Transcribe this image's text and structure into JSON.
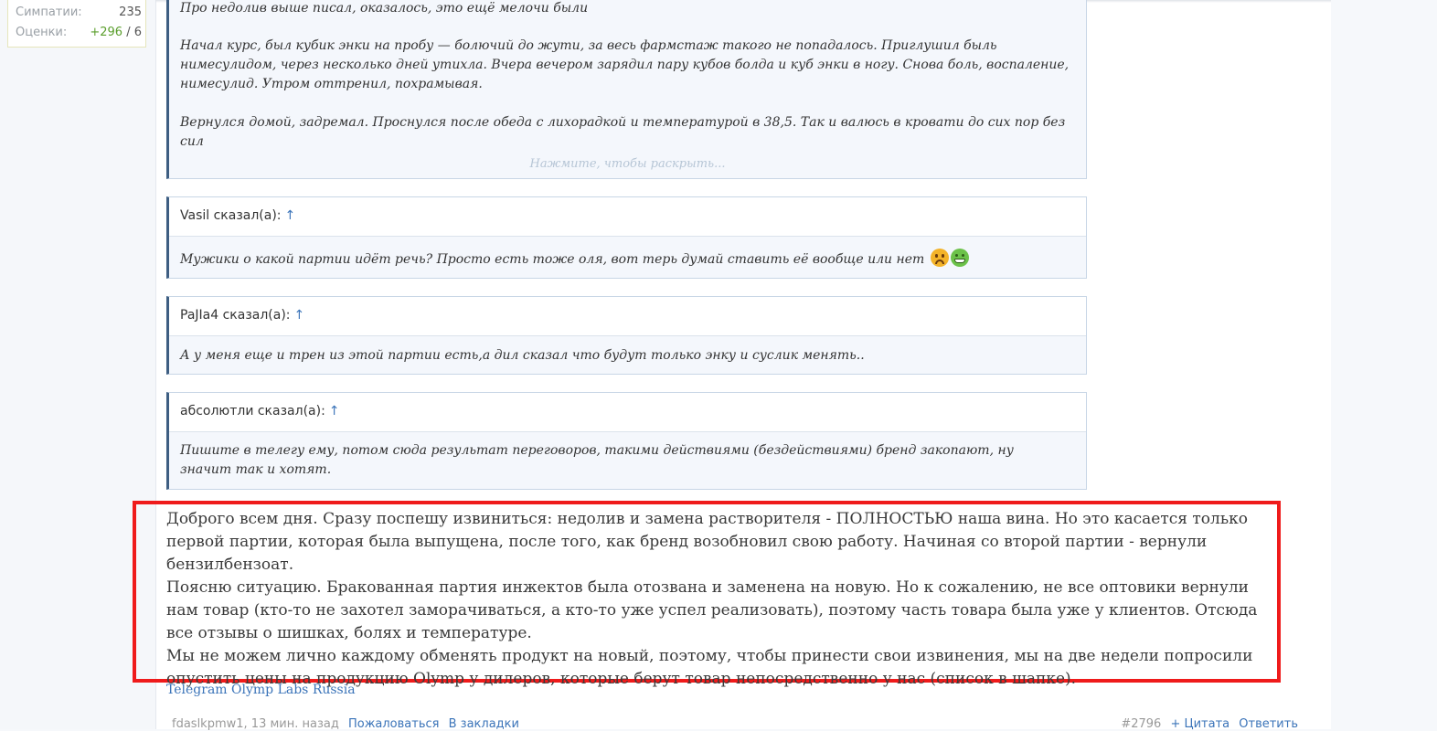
{
  "user_stats": {
    "likes_label": "Симпатии:",
    "likes_value": "235",
    "ratings_label": "Оценки:",
    "ratings_positive": "+296",
    "ratings_rest": " / 6"
  },
  "quotes": [
    {
      "paragraphs": [
        "Про недолив выше писал, оказалось, это ещё мелочи были",
        "Начал курс, был кубик энки на пробу — болючий до жути, за весь фармстаж такого не попадалось. Приглушил быль нимесулидом, через несколько дней утихла. Вчера вечером зарядил пару кубов болда и куб энки в ногу. Снова боль, воспаление, нимесулид. Утром оттренил, похрамывая.",
        "Вернулся домой, задремал. Проснулся после обеда с лихорадкой и температурой в 38,5. Так и валюсь в кровати до сих пор без сил"
      ],
      "expand_label": "Нажмите, чтобы раскрыть..."
    },
    {
      "author": "Vasil сказал(а):",
      "arrow": "↑",
      "text": "Мужики о какой партии идёт речь? Просто есть тоже оля, вот терь думай ставить её вообще или нет"
    },
    {
      "author": "PaJIa4 сказал(а):",
      "arrow": "↑",
      "text": "А у меня еще и трен из этой партии есть,а дил сказал что будут только энку и суслик менять.."
    },
    {
      "author": "абсолютли сказал(а):",
      "arrow": "↑",
      "text": "Пишите в телегу ему, потом сюда результат переговоров, такими действиями (бездействиями) бренд закопают, ну значит так и хотят."
    }
  ],
  "reply": {
    "paragraph1": "Доброго всем дня. Сразу поспешу извиниться: недолив и замена растворителя - ПОЛНОСТЬЮ наша вина. Но это касается только первой партии, которая была выпущена, после того, как бренд возобновил свою работу. Начиная со второй партии - вернули бензилбензоат.",
    "paragraph2": "Поясню ситуацию. Бракованная партия инжектов была отозвана и заменена на новую. Но к сожалению, не все оптовики вернули нам товар (кто-то не захотел заморачиваться, а кто-то уже успел реализовать), поэтому часть товара была уже у клиентов. Отсюда все отзывы о шишках, болях и температуре.",
    "paragraph3": "Мы не можем лично каждому обменять продукт на новый, поэтому, чтобы принести свои извинения, мы на две недели попросили опустить цены на продукцию Olymp у дилеров, которые берут товар непосредственно у нас (список в шапке)."
  },
  "signature_link": "Telegram Olymp Labs Russia",
  "post_meta": {
    "author": "fdaslkpmw1",
    "time": ", 13 мин. назад",
    "report": "Пожаловаться",
    "bookmark": "В закладки",
    "post_number": "#2796",
    "quote": "+ Цитата",
    "reply": "Ответить"
  },
  "colors": {
    "highlight_border": "#ef1b1b",
    "link": "#3b74b9",
    "quote_border": "#3e5e82"
  }
}
